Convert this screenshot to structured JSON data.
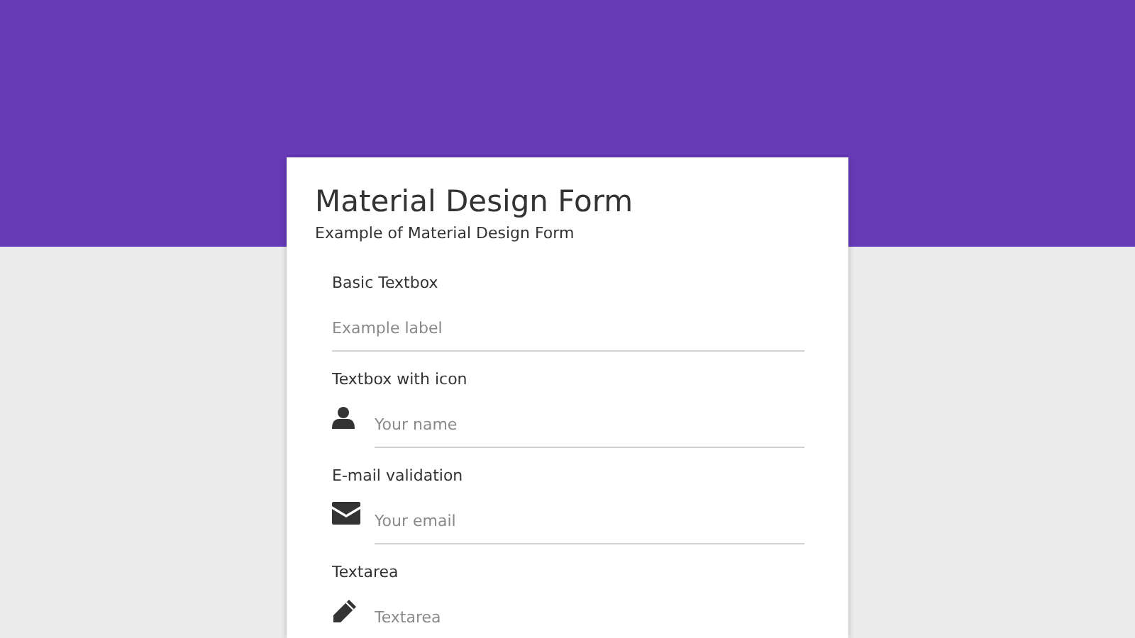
{
  "card": {
    "title": "Material Design Form",
    "subtitle": "Example of Material Design Form"
  },
  "fields": [
    {
      "kind": "text",
      "label": "Basic Textbox",
      "placeholder": "Example label"
    },
    {
      "kind": "name",
      "label": "Textbox with icon",
      "placeholder": "Your name"
    },
    {
      "kind": "email",
      "label": "E-mail validation",
      "placeholder": "Your email"
    },
    {
      "kind": "textarea",
      "label": "Textarea",
      "placeholder": "Textarea"
    }
  ]
}
